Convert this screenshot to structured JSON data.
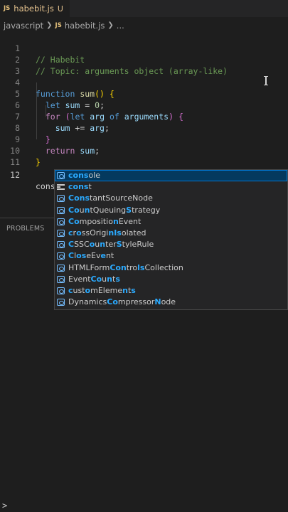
{
  "tab": {
    "icon": "JS",
    "filename": "habebit.js",
    "status": "U"
  },
  "breadcrumb": {
    "folder": "javascript",
    "icon": "JS",
    "file": "habebit.js",
    "more": "..."
  },
  "lines": [
    {
      "n": "1"
    },
    {
      "n": "2"
    },
    {
      "n": "3"
    },
    {
      "n": "4"
    },
    {
      "n": "5"
    },
    {
      "n": "6"
    },
    {
      "n": "7"
    },
    {
      "n": "8"
    },
    {
      "n": "9"
    },
    {
      "n": "10"
    },
    {
      "n": "11"
    },
    {
      "n": "12"
    }
  ],
  "code": {
    "l1": "// Habebit",
    "l2": "// Topic: arguments object (array-like)",
    "l4_kw": "function",
    "l4_fn": "sum",
    "l4_p1": "(",
    "l4_p2": ")",
    "l4_b": "{",
    "l5_kw": "let",
    "l5_var": "sum",
    "l5_eq": " = ",
    "l5_num": "0",
    "l5_semi": ";",
    "l6_ctl": "for",
    "l6_p1": "(",
    "l6_kw": "let",
    "l6_var": "arg",
    "l6_of": "of",
    "l6_args": "arguments",
    "l6_p2": ")",
    "l6_b": "{",
    "l7_var": "sum",
    "l7_op": " += ",
    "l7_arg": "arg",
    "l7_semi": ";",
    "l8_b": "}",
    "l9_ctl": "return",
    "l9_var": "sum",
    "l9_semi": ";",
    "l10_b": "}",
    "l12": "cons"
  },
  "panel": {
    "problems": "PROBLEMS"
  },
  "suggestions": [
    {
      "icon": "variable-icon",
      "parts": [
        [
          "hl",
          "cons"
        ],
        [
          "",
          "ole"
        ]
      ]
    },
    {
      "icon": "keyword-icon",
      "parts": [
        [
          "hl",
          "cons"
        ],
        [
          "",
          "t"
        ]
      ]
    },
    {
      "icon": "variable-icon",
      "parts": [
        [
          "hl",
          "Cons"
        ],
        [
          "",
          "tantSourceNode"
        ]
      ]
    },
    {
      "icon": "variable-icon",
      "parts": [
        [
          "hl",
          "Co"
        ],
        [
          "",
          "u"
        ],
        [
          "hl",
          "n"
        ],
        [
          "",
          "tQueuing"
        ],
        [
          "hl",
          "S"
        ],
        [
          "",
          "trategy"
        ]
      ]
    },
    {
      "icon": "variable-icon",
      "parts": [
        [
          "hl",
          "Co"
        ],
        [
          "",
          "mpositio"
        ],
        [
          "hl",
          "n"
        ],
        [
          "",
          "Event"
        ]
      ]
    },
    {
      "icon": "variable-icon",
      "parts": [
        [
          "hl",
          "c"
        ],
        [
          "",
          "r"
        ],
        [
          "hl",
          "o"
        ],
        [
          "",
          "ssOrigi"
        ],
        [
          "hl",
          "nIs"
        ],
        [
          "",
          "olated"
        ]
      ]
    },
    {
      "icon": "variable-icon",
      "parts": [
        [
          "hl",
          "C"
        ],
        [
          "",
          "SSC"
        ],
        [
          "hl",
          "o"
        ],
        [
          "",
          "u"
        ],
        [
          "hl",
          "n"
        ],
        [
          "",
          "ter"
        ],
        [
          "hl",
          "S"
        ],
        [
          "",
          "tyleRule"
        ]
      ]
    },
    {
      "icon": "variable-icon",
      "parts": [
        [
          "hl",
          "C"
        ],
        [
          "",
          "l"
        ],
        [
          "hl",
          "os"
        ],
        [
          "",
          "eEv"
        ],
        [
          "hl",
          "e"
        ],
        [
          "",
          "nt"
        ]
      ]
    },
    {
      "icon": "variable-icon",
      "parts": [
        [
          "",
          "HTMLForm"
        ],
        [
          "hl",
          "Con"
        ],
        [
          "",
          "tro"
        ],
        [
          "hl",
          "ls"
        ],
        [
          "",
          "Collection"
        ]
      ]
    },
    {
      "icon": "variable-icon",
      "parts": [
        [
          "",
          "Event"
        ],
        [
          "hl",
          "Co"
        ],
        [
          "",
          "u"
        ],
        [
          "hl",
          "n"
        ],
        [
          "",
          "t"
        ],
        [
          "hl",
          "s"
        ]
      ]
    },
    {
      "icon": "variable-icon",
      "parts": [
        [
          "hl",
          "c"
        ],
        [
          "",
          "ust"
        ],
        [
          "hl",
          "o"
        ],
        [
          "",
          "mEleme"
        ],
        [
          "hl",
          "n"
        ],
        [
          "",
          "t"
        ],
        [
          "hl",
          "s"
        ]
      ]
    },
    {
      "icon": "variable-icon",
      "parts": [
        [
          "",
          "Dynamics"
        ],
        [
          "hl",
          "Co"
        ],
        [
          "",
          "mpressor"
        ],
        [
          "hl",
          "N"
        ],
        [
          "",
          "ode"
        ]
      ]
    }
  ],
  "terminal": {
    "prompt": ">"
  }
}
